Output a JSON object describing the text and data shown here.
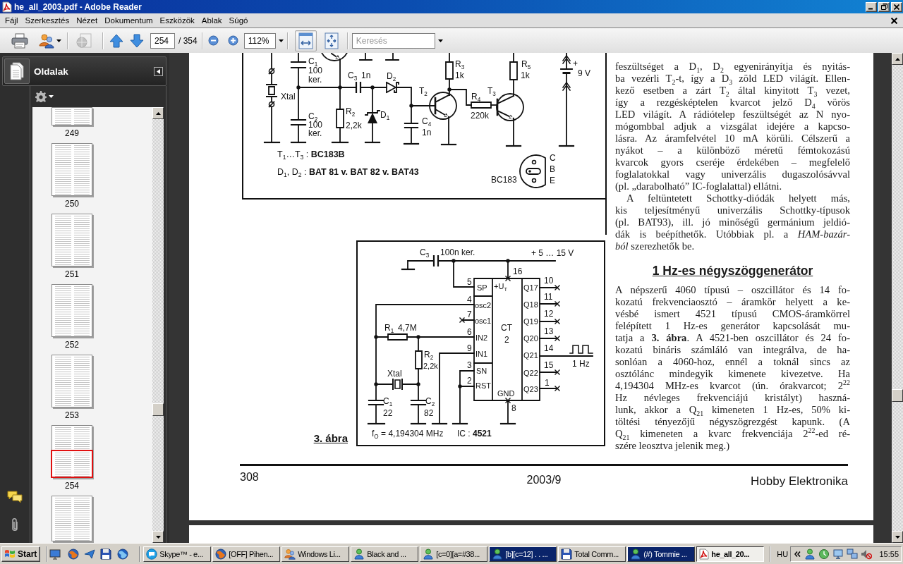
{
  "window": {
    "title": "he_all_2003.pdf - Adobe Reader"
  },
  "menu": {
    "items": [
      "Fájl",
      "Szerkesztés",
      "Nézet",
      "Dokumentum",
      "Eszközök",
      "Ablak",
      "Súgó"
    ]
  },
  "toolbar": {
    "groups": [
      {
        "tools": [
          {
            "kind": "print",
            "disabled": false
          },
          {
            "kind": "share",
            "disabled": false
          }
        ]
      },
      {
        "tools": [
          {
            "kind": "review",
            "disabled": true
          }
        ]
      },
      {
        "tools": [
          {
            "kind": "previous-page",
            "disabled": false
          },
          {
            "kind": "next-page",
            "disabled": false
          }
        ]
      }
    ],
    "page_field": {
      "value": "254"
    },
    "page_count": "/ 354",
    "zoom_tools": [
      {
        "kind": "zoom-out"
      },
      {
        "kind": "zoom-in"
      }
    ],
    "zoom_field": {
      "value": "112%"
    },
    "view_modes": [
      {
        "kind": "fit-width",
        "selected": true
      },
      {
        "kind": "fit-page",
        "selected": false
      }
    ],
    "search_field": {
      "placeholder": "Keresés"
    }
  },
  "sidebar": {
    "tabs": [
      {
        "kind": "pages",
        "selected": true
      },
      {
        "kind": "comments",
        "selected": false
      },
      {
        "kind": "attachments",
        "selected": false
      }
    ],
    "title": "Oldalak",
    "thumbnails": [
      {
        "label": "249",
        "selected": false
      },
      {
        "label": "250",
        "selected": false
      },
      {
        "label": "251",
        "selected": false
      },
      {
        "label": "252",
        "selected": false
      },
      {
        "label": "253",
        "selected": false
      },
      {
        "label": "254",
        "selected": true
      },
      {
        "selected": false
      }
    ]
  },
  "document": {
    "figure_1": {
      "labels": [
        "C$_{1}$",
        "100",
        "ker.",
        "C$_{3}$",
        "1n",
        "D$_{2}$",
        "R$_{3}$",
        "1k",
        "R$_{5}$",
        "1k",
        "+",
        "9 V",
        "Xtal",
        "T$_{2}$",
        "R$_{4}$",
        "T$_{3}$",
        "C$_{2}$",
        "100",
        "ker.",
        "R$_{2}$",
        "2,2k",
        "D$_{1}$",
        "220k",
        "C$_{4}$",
        "1n",
        "T$_{1}$…T$_{3}$ : **BC183B**",
        "C",
        "D$_{1}$, D$_{2}$ : **BAT 81 v. BAT 82 v. BAT43**",
        "B",
        "BC183",
        "E"
      ]
    },
    "figure_3": {
      "caption": "3. ábra",
      "labels": [
        "C$_{3}$",
        "100n ker.",
        "+ 5 … 15 V",
        "16",
        "5",
        "SP",
        "+U$_{T}$",
        "Q17",
        "10",
        "4",
        "osc2",
        "Q18",
        "11",
        "7",
        "osc1",
        "Q19",
        "12",
        "R$_{1}$",
        "4,7M",
        "6",
        "IN2",
        "CT",
        "2",
        "Q20",
        "13",
        "R$_{2}$",
        "9",
        "IN1",
        "Q21",
        "14",
        "Xtal",
        "2,2k",
        "3",
        "SN",
        "Q22",
        "15",
        "1 Hz",
        "2",
        "RST",
        "Q23",
        "1",
        "GND",
        "C$_{1}$",
        "C$_{2}$",
        "8",
        "22",
        "82",
        "f$_{O}$ = 4,194304 MHz",
        "IC : **4521**"
      ]
    },
    "column": [
      {
        "kind": "paragraph",
        "indent": false,
        "lines": [
          "feszültséget a D$_{1}$, D$_{2}$ egyenirányítja és nyitás-",
          "ba vezérli T$_{2}$-t, így a D$_{3}$ zöld LED világít. Ellen-",
          "kező esetben a zárt T$_{2}$ által kinyitott T$_{3}$ vezet,",
          "így a rezgésképtelen kvarcot jelző D$_{4}$ vörös",
          "LED világít. A rádiótelep feszültségét az N nyo-",
          "mógombbal adjuk a vizsgálat idejére a kapcso-",
          "lásra. Az áramfelvétel 10 mA körüli. Célszerű a",
          "nyákot – a különböző méretű fémtokozású",
          "kvarcok gyors cseréje érdekében – megfelelő",
          "foglalatokkal vagy univerzális dugaszolósávval",
          "(pl. „darabolható” IC-foglalattal) ellátni."
        ]
      },
      {
        "kind": "paragraph",
        "indent": true,
        "lines": [
          "A feltüntetett Schottky-diódák helyett más,",
          "kis teljesítményű univerzális Schottky-típusok",
          "(pl. BAT93), ill. jó minőségű germánium jeldió-",
          "dák is beépíthetők. Utóbbiak pl. a *HAM-bazár-*",
          "*ból* szerezhetők be."
        ]
      },
      {
        "kind": "heading",
        "text": "1 Hz-es négyszöggenerátor"
      },
      {
        "kind": "paragraph",
        "indent": false,
        "lines": [
          "A népszerű 4060 típusú – oszcillátor és 14 fo-",
          "kozatú frekvenciaosztó – áramkör helyett a ke-",
          "vésbé ismert 4521 típusú CMOS-áramkörrel",
          "felépített 1 Hz-es generátor kapcsolását mu-",
          "tatja a **3. ábra**. A 4521-ben oszcillátor és 24 fo-",
          "kozatú bináris számláló van integrálva, de ha-",
          "sonlóan a 4060-hoz, ennél a toknál sincs az",
          "osztólánc mindegyik kimenete kivezetve. Ha",
          "4,194304 MHz-es kvarcot (ún. órakvarcot; 2$^{22}$",
          "Hz névleges frekvenciájú kristályt) haszná-",
          "lunk, akkor a Q$_{21}$ kimeneten 1 Hz-es, 50% ki-",
          "töltési tényezőjű négyszögrezgést kapunk. (A",
          "Q$_{21}$ kimeneten a kvarc frekvenciája 2$^{22}$-ed ré-",
          "szére leosztva jelenik meg.)"
        ]
      }
    ],
    "footer": {
      "page_number": "308",
      "issue": "2003/9",
      "magazine": "Hobby Elektronika"
    }
  },
  "taskbar": {
    "start": "Start",
    "tasks": [
      {
        "label": "Skype™ - e...",
        "kind": "skype",
        "selected": false,
        "flashing": false
      },
      {
        "label": "[OFF] Pihen...",
        "kind": "firefox",
        "selected": false,
        "flashing": false
      },
      {
        "label": "Windows Li...",
        "kind": "live",
        "selected": false,
        "flashing": false
      },
      {
        "label": "Black and ...",
        "kind": "messenger",
        "selected": false,
        "flashing": false
      },
      {
        "label": "[c=0][a=#38...",
        "kind": "messenger",
        "selected": false,
        "flashing": false
      },
      {
        "label": "[b][c=12] . . ...",
        "kind": "messenger",
        "selected": false,
        "flashing": true
      },
      {
        "label": "Total Comm...",
        "kind": "files",
        "selected": false,
        "flashing": false
      },
      {
        "label": "(#) Tommie ...",
        "kind": "messenger",
        "selected": false,
        "flashing": true
      },
      {
        "label": "he_all_20...",
        "kind": "pdf",
        "selected": true,
        "flashing": false
      }
    ],
    "language": "HU",
    "clock": "15:55"
  }
}
